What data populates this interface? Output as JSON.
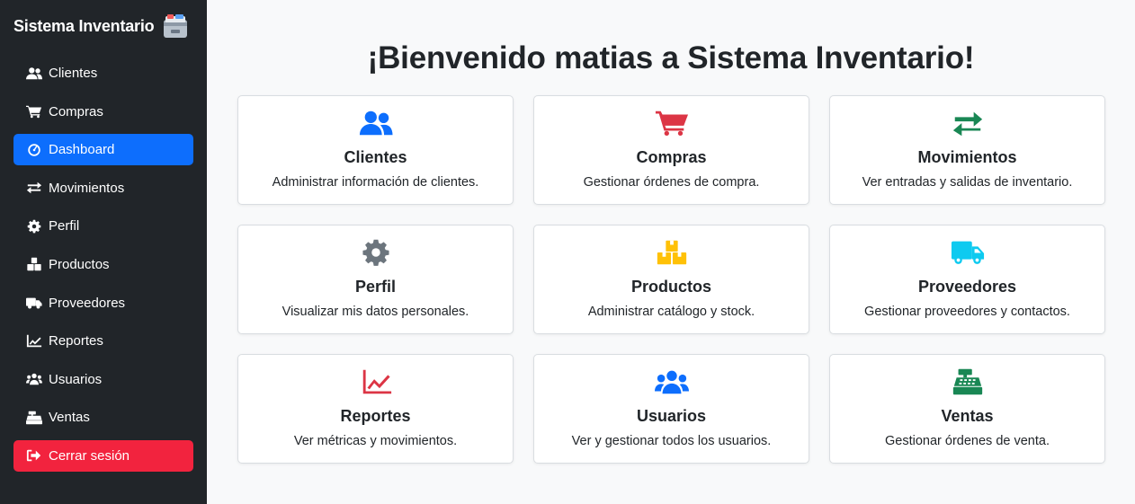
{
  "sidebar": {
    "brand_title": "Sistema Inventario",
    "brand_icon": "card-file-box-icon",
    "items": [
      {
        "label": "Clientes",
        "icon": "users-icon"
      },
      {
        "label": "Compras",
        "icon": "cart-icon"
      },
      {
        "label": "Dashboard",
        "icon": "gauge-icon",
        "active": true
      },
      {
        "label": "Movimientos",
        "icon": "swap-arrows-icon"
      },
      {
        "label": "Perfil",
        "icon": "gear-icon"
      },
      {
        "label": "Productos",
        "icon": "boxes-icon"
      },
      {
        "label": "Proveedores",
        "icon": "truck-icon"
      },
      {
        "label": "Reportes",
        "icon": "chart-line-icon"
      },
      {
        "label": "Usuarios",
        "icon": "users-group-icon"
      },
      {
        "label": "Ventas",
        "icon": "cash-register-icon"
      }
    ],
    "logout_label": "Cerrar sesión"
  },
  "main": {
    "welcome": "¡Bienvenido matias a Sistema Inventario!",
    "cards": [
      {
        "title": "Clientes",
        "desc": "Administrar información de clientes.",
        "icon": "users-icon",
        "color": "#0d6efd"
      },
      {
        "title": "Compras",
        "desc": "Gestionar órdenes de compra.",
        "icon": "cart-icon",
        "color": "#dc3545"
      },
      {
        "title": "Movimientos",
        "desc": "Ver entradas y salidas de inventario.",
        "icon": "swap-arrows-icon",
        "color": "#198754"
      },
      {
        "title": "Perfil",
        "desc": "Visualizar mis datos personales.",
        "icon": "gear-icon",
        "color": "#6c757d"
      },
      {
        "title": "Productos",
        "desc": "Administrar catálogo y stock.",
        "icon": "boxes-icon",
        "color": "#ffc107"
      },
      {
        "title": "Proveedores",
        "desc": "Gestionar proveedores y contactos.",
        "icon": "truck-icon",
        "color": "#0dcaf0"
      },
      {
        "title": "Reportes",
        "desc": "Ver métricas y movimientos.",
        "icon": "chart-line-icon",
        "color": "#dc3545"
      },
      {
        "title": "Usuarios",
        "desc": "Ver y gestionar todos los usuarios.",
        "icon": "users-group-icon",
        "color": "#0d6efd"
      },
      {
        "title": "Ventas",
        "desc": "Gestionar órdenes de venta.",
        "icon": "cash-register-icon",
        "color": "#198754"
      }
    ]
  }
}
